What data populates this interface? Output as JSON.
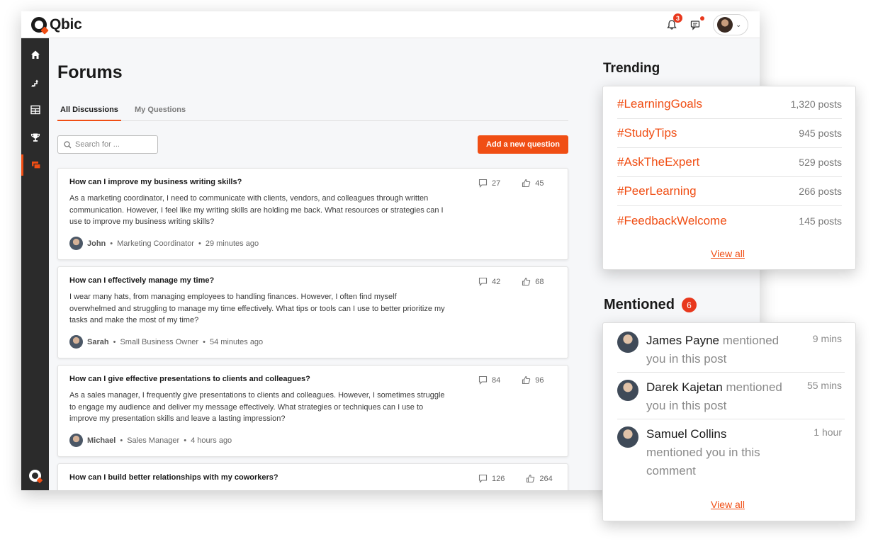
{
  "app": {
    "brand": "Qbic",
    "notifications_count": "3",
    "icons": {
      "bell": "bell-icon",
      "chat": "chat-icon",
      "chevron": "chevron-down-icon"
    }
  },
  "sidebar": {
    "items": [
      {
        "icon": "home-icon",
        "glyph": "⌂"
      },
      {
        "icon": "career-path-icon",
        "glyph": "⤴"
      },
      {
        "icon": "dashboard-icon",
        "glyph": "▦"
      },
      {
        "icon": "trophy-icon",
        "glyph": "🏆"
      },
      {
        "icon": "forums-icon",
        "glyph": "▣"
      }
    ]
  },
  "page": {
    "title": "Forums",
    "tabs": [
      "All Discussions",
      "My Questions"
    ],
    "search_placeholder": "Search for ...",
    "add_button": "Add a new question"
  },
  "posts": [
    {
      "title": "How can I improve my business writing skills?",
      "body": "As a marketing coordinator, I need to communicate with clients, vendors, and colleagues through written communication. However, I feel like my writing skills are holding me back. What resources or strategies can I use to improve my business writing skills?",
      "comments": "27",
      "likes": "45",
      "author": "John",
      "role": "Marketing Coordinator",
      "time": "29 minutes ago"
    },
    {
      "title": "How can I effectively manage my time?",
      "body": "I wear many hats, from managing employees to handling finances. However, I often find myself overwhelmed and struggling to manage my time effectively. What tips or tools can I use to better prioritize my tasks and make the most of my time?",
      "comments": "42",
      "likes": "68",
      "author": "Sarah",
      "role": "Small Business Owner",
      "time": "54 minutes ago"
    },
    {
      "title": "How can I give effective presentations to clients and colleagues?",
      "body": "As a sales manager, I frequently give presentations to clients and colleagues. However, I sometimes struggle to engage my audience and deliver my message effectively. What strategies or techniques can I use to improve my presentation skills and leave a lasting impression?",
      "comments": "84",
      "likes": "96",
      "author": "Michael",
      "role": "Sales Manager",
      "time": "4 hours ago"
    },
    {
      "title": "How can I build better relationships with my coworkers?",
      "body": "",
      "comments": "126",
      "likes": "264",
      "author": "",
      "role": "",
      "time": ""
    }
  ],
  "trending": {
    "heading": "Trending",
    "items": [
      {
        "tag": "#LearningGoals",
        "count": "1,320 posts"
      },
      {
        "tag": "#StudyTips",
        "count": "945 posts"
      },
      {
        "tag": "#AskTheExpert",
        "count": "529 posts"
      },
      {
        "tag": "#PeerLearning",
        "count": "266 posts"
      },
      {
        "tag": "#FeedbackWelcome",
        "count": "145 posts"
      }
    ],
    "view_all": "View all"
  },
  "mentioned": {
    "heading": "Mentioned",
    "count": "6",
    "items": [
      {
        "name": "James Payne",
        "text": "mentioned you in this post",
        "time": "9 mins"
      },
      {
        "name": "Darek Kajetan",
        "text": "mentioned you in this post",
        "time": "55 mins"
      },
      {
        "name": "Samuel Collins",
        "text": "mentioned you in this comment",
        "time": "1 hour"
      }
    ],
    "view_all": "View all"
  },
  "colors": {
    "accent": "#f04e14",
    "badge": "#e8381d",
    "sidebar": "#2b2b2b"
  }
}
